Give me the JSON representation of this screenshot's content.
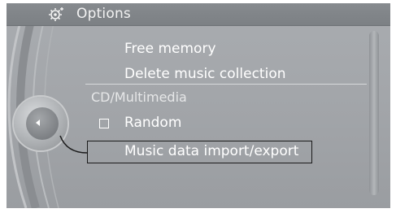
{
  "header": {
    "title": "Options",
    "icon": "options-gear-icon"
  },
  "menu": {
    "items_top": [
      {
        "label": "Free memory"
      },
      {
        "label": "Delete music collection"
      }
    ],
    "section_title": "CD/Multimedia",
    "items_section": [
      {
        "label": "Random",
        "type": "checkbox",
        "checked": false
      },
      {
        "label": "Music data import/export",
        "highlighted": true
      }
    ]
  },
  "controller": {
    "icon": "controller-left-arrow-icon"
  },
  "colors": {
    "background": "#a3a6aa",
    "header": "#7c8084",
    "text": "#ffffff",
    "highlight_border": "#1a1a1a"
  }
}
